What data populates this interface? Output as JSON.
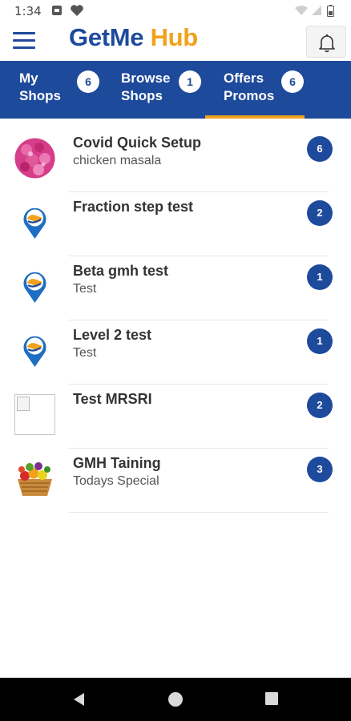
{
  "status_bar": {
    "time": "1:34",
    "icons": [
      "sim-card-icon",
      "heart-icon",
      "wifi-icon",
      "signal-icon",
      "battery-icon"
    ]
  },
  "app_bar": {
    "brand_part1": "GetMe",
    "brand_part2": "Hub",
    "menu_icon": "hamburger-menu-icon",
    "notification_icon": "bell-icon"
  },
  "tabs": [
    {
      "label_line1": "My",
      "label_line2": "Shops",
      "count": "6",
      "active": false
    },
    {
      "label_line1": "Browse",
      "label_line2": "Shops",
      "count": "1",
      "active": false
    },
    {
      "label_line1": "Offers",
      "label_line2": "Promos",
      "count": "6",
      "active": true
    }
  ],
  "shops": [
    {
      "title": "Covid Quick Setup",
      "subtitle": "chicken masala",
      "count": "6",
      "avatar": "food-photo"
    },
    {
      "title": "Fraction step test",
      "subtitle": "",
      "count": "2",
      "avatar": "map-pin-icon"
    },
    {
      "title": "Beta gmh test",
      "subtitle": "Test",
      "count": "1",
      "avatar": "map-pin-icon"
    },
    {
      "title": "Level 2 test",
      "subtitle": "Test",
      "count": "1",
      "avatar": "map-pin-icon"
    },
    {
      "title": "Test MRSRI",
      "subtitle": "",
      "count": "2",
      "avatar": "broken-image-icon"
    },
    {
      "title": "GMH Taining",
      "subtitle": "Todays Special",
      "count": "3",
      "avatar": "fruit-basket-photo"
    }
  ],
  "colors": {
    "primary": "#1e4a9c",
    "accent": "#f0a21b",
    "badge": "#1e4a9c"
  },
  "nav_bar": {
    "icons": [
      "back-triangle-icon",
      "home-circle-icon",
      "recents-square-icon"
    ]
  }
}
